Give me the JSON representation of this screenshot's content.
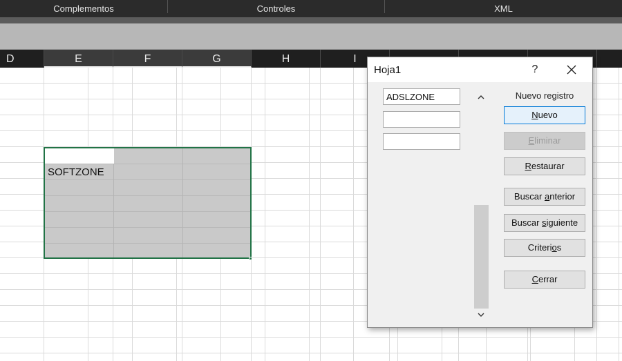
{
  "ribbon": {
    "groups": [
      "Complementos",
      "Controles",
      "XML"
    ]
  },
  "columns": [
    "D",
    "E",
    "F",
    "G",
    "H",
    "I"
  ],
  "selected_columns": [
    "E",
    "F",
    "G"
  ],
  "cells": {
    "e_active_value": "SOFTZONE"
  },
  "dialog": {
    "title": "Hoja1",
    "help_label": "?",
    "close_icon": "close-icon",
    "fields": [
      "ADSLZONE",
      "",
      ""
    ],
    "record_status": "Nuevo registro",
    "buttons": {
      "new": {
        "pre": "",
        "key": "N",
        "post": "uevo"
      },
      "delete": {
        "pre": "",
        "key": "E",
        "post": "liminar"
      },
      "restore": {
        "pre": "",
        "key": "R",
        "post": "estaurar"
      },
      "find_prev": {
        "pre": "Buscar ",
        "key": "a",
        "post": "nterior"
      },
      "find_next": {
        "pre": "Buscar ",
        "key": "s",
        "post": "iguiente"
      },
      "criteria": {
        "pre": "Criteri",
        "key": "o",
        "post": "s"
      },
      "close": {
        "pre": "",
        "key": "C",
        "post": "errar"
      }
    }
  },
  "colors": {
    "selection_border": "#217346",
    "primary_border": "#0078d7"
  }
}
